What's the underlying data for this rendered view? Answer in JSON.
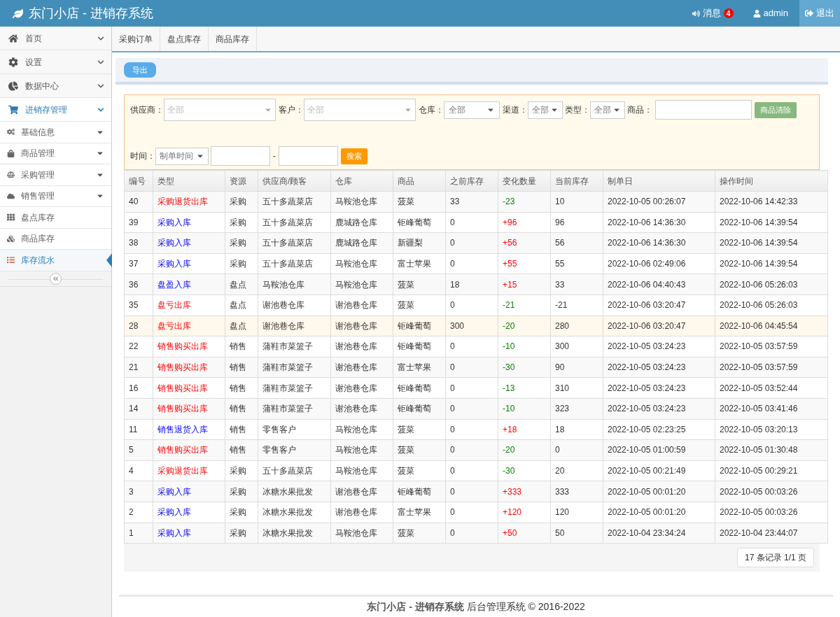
{
  "header": {
    "title": "东门小店 - 进销存系统",
    "messages": {
      "label": "消息",
      "count": "4"
    },
    "user": "admin",
    "logout": "退出"
  },
  "sidebar": {
    "items": [
      {
        "label": "首页",
        "expanded": false,
        "selected": false
      },
      {
        "label": "设置",
        "expanded": false,
        "selected": false
      },
      {
        "label": "数据中心",
        "expanded": false,
        "selected": false
      },
      {
        "label": "进销存管理",
        "expanded": true,
        "selected": true,
        "children": [
          {
            "label": "基础信息",
            "has_submenu": true,
            "selected": false
          },
          {
            "label": "商品管理",
            "has_submenu": true,
            "selected": false
          },
          {
            "label": "采购管理",
            "has_submenu": true,
            "selected": false
          },
          {
            "label": "销售管理",
            "has_submenu": true,
            "selected": false
          },
          {
            "label": "盘点库存",
            "has_submenu": false,
            "selected": false
          },
          {
            "label": "商品库存",
            "has_submenu": false,
            "selected": false
          },
          {
            "label": "库存流水",
            "has_submenu": false,
            "selected": true
          }
        ]
      }
    ]
  },
  "tabs": [
    {
      "label": "采购订单",
      "selected": false
    },
    {
      "label": "盘点库存",
      "selected": false
    },
    {
      "label": "商品库存",
      "selected": false
    }
  ],
  "toolbar": {
    "export": "导出"
  },
  "filters": {
    "supplier": {
      "label": "供应商：",
      "placeholder": "全部"
    },
    "customer": {
      "label": "客户：",
      "placeholder": "全部"
    },
    "warehouse": {
      "label": "仓库：",
      "value": "全部"
    },
    "channel": {
      "label": "渠道：",
      "value": "全部"
    },
    "type": {
      "label": "类型：",
      "value": "全部"
    },
    "product": {
      "label": "商品："
    },
    "clear": "商品清除",
    "time": {
      "label": "时间：",
      "value": "制单时间"
    },
    "separator": "-",
    "search": "搜索"
  },
  "table": {
    "columns": [
      "编号",
      "类型",
      "资源",
      "供应商/顾客",
      "仓库",
      "商品",
      "之前库存",
      "变化数量",
      "当前库存",
      "制单日",
      "操作时间"
    ],
    "rows": [
      {
        "id": "40",
        "kind": "out",
        "type": "采购退货出库",
        "source": "采购",
        "party": "五十多蔬菜店",
        "warehouse": "马鞍池仓库",
        "product": "菠菜",
        "before": "33",
        "change": "-23",
        "after": "10",
        "created": "2022-10-05 00:26:07",
        "operated": "2022-10-06 14:42:33",
        "highlighted": false
      },
      {
        "id": "39",
        "kind": "in",
        "type": "采购入库",
        "source": "采购",
        "party": "五十多蔬菜店",
        "warehouse": "鹿城路仓库",
        "product": "钜峰葡萄",
        "before": "0",
        "change": "+96",
        "after": "96",
        "created": "2022-10-06 14:36:30",
        "operated": "2022-10-06 14:39:54",
        "highlighted": false
      },
      {
        "id": "38",
        "kind": "in",
        "type": "采购入库",
        "source": "采购",
        "party": "五十多蔬菜店",
        "warehouse": "鹿城路仓库",
        "product": "新疆梨",
        "before": "0",
        "change": "+56",
        "after": "56",
        "created": "2022-10-06 14:36:30",
        "operated": "2022-10-06 14:39:54",
        "highlighted": false
      },
      {
        "id": "37",
        "kind": "in",
        "type": "采购入库",
        "source": "采购",
        "party": "五十多蔬菜店",
        "warehouse": "马鞍池仓库",
        "product": "富士苹果",
        "before": "0",
        "change": "+55",
        "after": "55",
        "created": "2022-10-06 02:49:06",
        "operated": "2022-10-06 14:39:54",
        "highlighted": false
      },
      {
        "id": "36",
        "kind": "in",
        "type": "盘盈入库",
        "source": "盘点",
        "party": "马鞍池仓库",
        "warehouse": "马鞍池仓库",
        "product": "菠菜",
        "before": "18",
        "change": "+15",
        "after": "33",
        "created": "2022-10-06 04:40:43",
        "operated": "2022-10-06 05:26:03",
        "highlighted": false
      },
      {
        "id": "35",
        "kind": "out",
        "type": "盘亏出库",
        "source": "盘点",
        "party": "谢池巷仓库",
        "warehouse": "谢池巷仓库",
        "product": "菠菜",
        "before": "0",
        "change": "-21",
        "after": "-21",
        "created": "2022-10-06 03:20:47",
        "operated": "2022-10-06 05:26:03",
        "highlighted": false
      },
      {
        "id": "28",
        "kind": "out",
        "type": "盘亏出库",
        "source": "盘点",
        "party": "谢池巷仓库",
        "warehouse": "谢池巷仓库",
        "product": "钜峰葡萄",
        "before": "300",
        "change": "-20",
        "after": "280",
        "created": "2022-10-06 03:20:47",
        "operated": "2022-10-06 04:45:54",
        "highlighted": true
      },
      {
        "id": "22",
        "kind": "out",
        "type": "销售购买出库",
        "source": "销售",
        "party": "蒲鞋市菜篮子",
        "warehouse": "谢池巷仓库",
        "product": "钜峰葡萄",
        "before": "0",
        "change": "-10",
        "after": "300",
        "created": "2022-10-05 03:24:23",
        "operated": "2022-10-05 03:57:59",
        "highlighted": false
      },
      {
        "id": "21",
        "kind": "out",
        "type": "销售购买出库",
        "source": "销售",
        "party": "蒲鞋市菜篮子",
        "warehouse": "谢池巷仓库",
        "product": "富士苹果",
        "before": "0",
        "change": "-30",
        "after": "90",
        "created": "2022-10-05 03:24:23",
        "operated": "2022-10-05 03:57:59",
        "highlighted": false
      },
      {
        "id": "16",
        "kind": "out",
        "type": "销售购买出库",
        "source": "销售",
        "party": "蒲鞋市菜篮子",
        "warehouse": "谢池巷仓库",
        "product": "钜峰葡萄",
        "before": "0",
        "change": "-13",
        "after": "310",
        "created": "2022-10-05 03:24:23",
        "operated": "2022-10-05 03:52:44",
        "highlighted": false
      },
      {
        "id": "14",
        "kind": "out",
        "type": "销售购买出库",
        "source": "销售",
        "party": "蒲鞋市菜篮子",
        "warehouse": "谢池巷仓库",
        "product": "钜峰葡萄",
        "before": "0",
        "change": "-10",
        "after": "323",
        "created": "2022-10-05 03:24:23",
        "operated": "2022-10-05 03:41:46",
        "highlighted": false
      },
      {
        "id": "11",
        "kind": "in",
        "type": "销售退货入库",
        "source": "销售",
        "party": "零售客户",
        "warehouse": "马鞍池仓库",
        "product": "菠菜",
        "before": "0",
        "change": "+18",
        "after": "18",
        "created": "2022-10-05 02:23:25",
        "operated": "2022-10-05 03:20:13",
        "highlighted": false
      },
      {
        "id": "5",
        "kind": "out",
        "type": "销售购买出库",
        "source": "销售",
        "party": "零售客户",
        "warehouse": "马鞍池仓库",
        "product": "菠菜",
        "before": "0",
        "change": "-20",
        "after": "0",
        "created": "2022-10-05 01:00:59",
        "operated": "2022-10-05 01:30:48",
        "highlighted": false
      },
      {
        "id": "4",
        "kind": "out",
        "type": "采购退货出库",
        "source": "采购",
        "party": "五十多蔬菜店",
        "warehouse": "马鞍池仓库",
        "product": "菠菜",
        "before": "0",
        "change": "-30",
        "after": "20",
        "created": "2022-10-05 00:21:49",
        "operated": "2022-10-05 00:29:21",
        "highlighted": false
      },
      {
        "id": "3",
        "kind": "in",
        "type": "采购入库",
        "source": "采购",
        "party": "冰糖水果批发",
        "warehouse": "谢池巷仓库",
        "product": "钜峰葡萄",
        "before": "0",
        "change": "+333",
        "after": "333",
        "created": "2022-10-05 00:01:20",
        "operated": "2022-10-05 00:03:26",
        "highlighted": false
      },
      {
        "id": "2",
        "kind": "in",
        "type": "采购入库",
        "source": "采购",
        "party": "冰糖水果批发",
        "warehouse": "谢池巷仓库",
        "product": "富士苹果",
        "before": "0",
        "change": "+120",
        "after": "120",
        "created": "2022-10-05 00:01:20",
        "operated": "2022-10-05 00:03:26",
        "highlighted": false
      },
      {
        "id": "1",
        "kind": "in",
        "type": "采购入库",
        "source": "采购",
        "party": "冰糖水果批发",
        "warehouse": "马鞍池仓库",
        "product": "菠菜",
        "before": "0",
        "change": "+50",
        "after": "50",
        "created": "2022-10-04 23:34:24",
        "operated": "2022-10-04 23:44:07",
        "highlighted": false
      }
    ]
  },
  "pagination": "17 条记录 1/1 页",
  "footer": {
    "brand": "东门小店 - 进销存系统",
    "text": "后台管理系统 © 2016-2022"
  }
}
